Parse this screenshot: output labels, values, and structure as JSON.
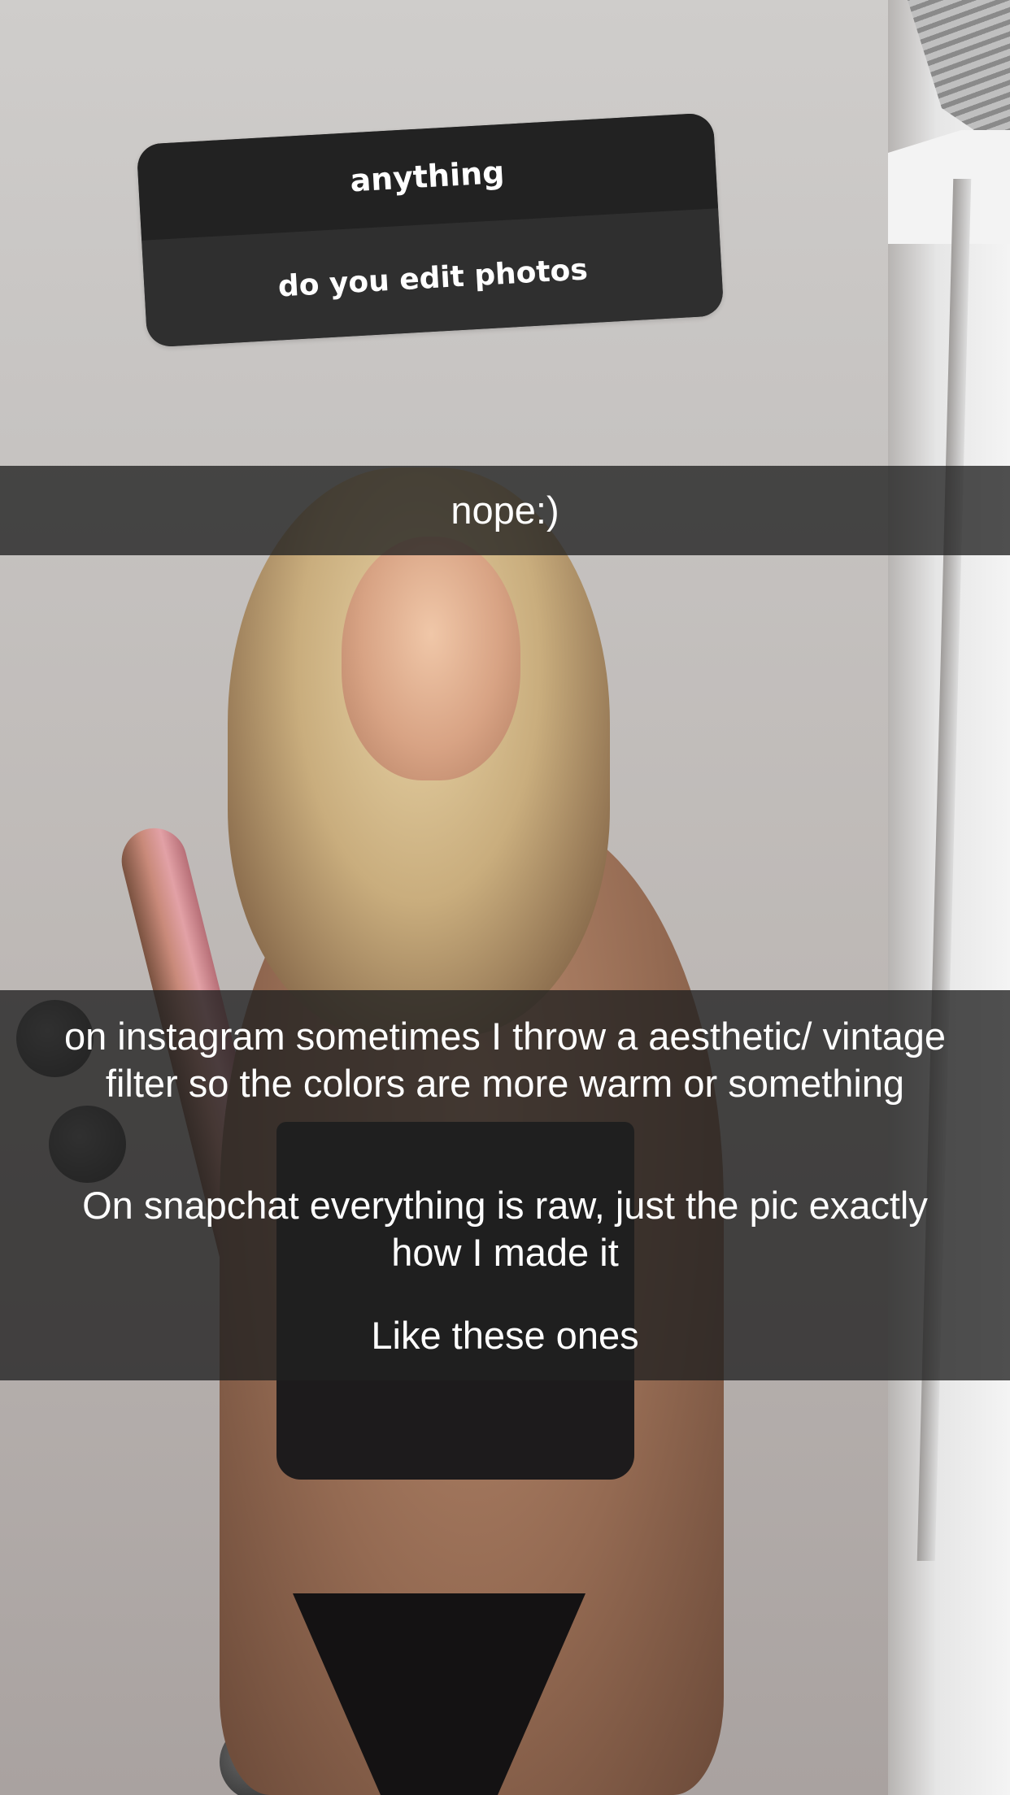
{
  "story": {
    "question_sticker": {
      "prompt": "anything",
      "question": "do you edit photos"
    },
    "captions": [
      "nope:)",
      "on instagram sometimes I throw a aesthetic/ vintage filter so the colors are more warm or something",
      "On snapchat everything is raw, just the pic exactly how I made it",
      "Like these ones"
    ]
  },
  "colors": {
    "sticker_top": "#222222",
    "sticker_bottom": "#2f2f2f",
    "caption_bar": "#202020",
    "text": "#ffffff"
  }
}
